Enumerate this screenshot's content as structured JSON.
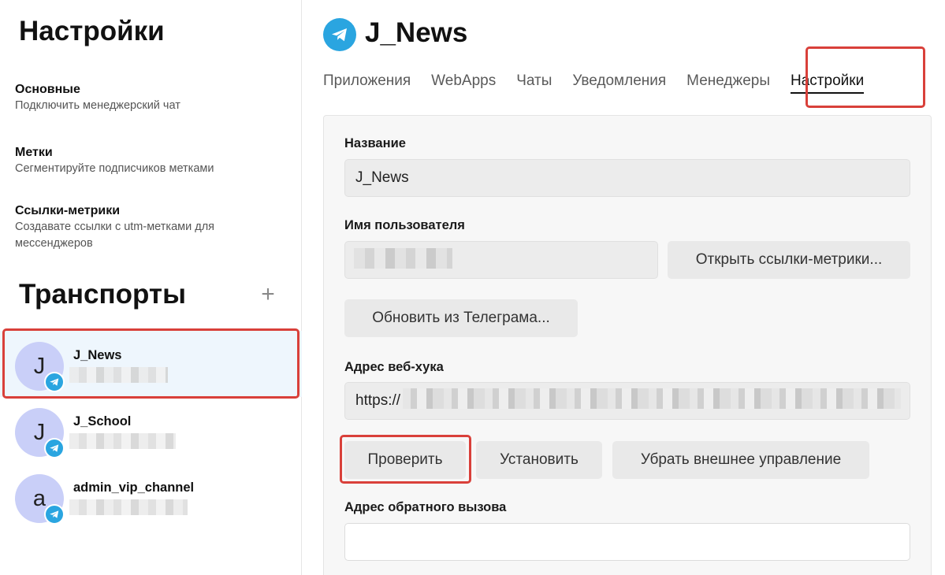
{
  "sidebar": {
    "title": "Настройки",
    "menu": [
      {
        "title": "Основные",
        "desc": "Подключить менеджерский чат"
      },
      {
        "title": "Метки",
        "desc": "Сегментируйте подписчиков метками"
      },
      {
        "title": "Ссылки-метрики",
        "desc": "Создавате ссылки с utm-метками для мессенджеров"
      }
    ],
    "transports_title": "Транспорты",
    "add_symbol": "+",
    "transports": [
      {
        "initial": "J",
        "name": "J_News",
        "icon": "telegram-icon",
        "selected": true
      },
      {
        "initial": "J",
        "name": "J_School",
        "icon": "telegram-icon",
        "selected": false
      },
      {
        "initial": "a",
        "name": "admin_vip_channel",
        "icon": "telegram-icon",
        "selected": false
      }
    ]
  },
  "header": {
    "title": "J_News",
    "icon": "telegram-icon",
    "tabs": [
      {
        "label": "Приложения",
        "active": false
      },
      {
        "label": "WebApps",
        "active": false
      },
      {
        "label": "Чаты",
        "active": false
      },
      {
        "label": "Уведомления",
        "active": false
      },
      {
        "label": "Менеджеры",
        "active": false
      },
      {
        "label": "Настройки",
        "active": true
      }
    ]
  },
  "form": {
    "name_label": "Название",
    "name_value": "J_News",
    "username_label": "Имя пользователя",
    "open_links_button": "Открыть ссылки-метрики...",
    "refresh_button": "Обновить из Телеграма...",
    "webhook_label": "Адрес веб-хука",
    "webhook_prefix": "https://",
    "check_button": "Проверить",
    "install_button": "Установить",
    "remove_control_button": "Убрать внешнее управление",
    "callback_label": "Адрес обратного вызова",
    "callback_value": ""
  },
  "colors": {
    "accent_telegram": "#2aa5e0",
    "highlight": "#d9403a",
    "avatar": "#c9cff8",
    "selected_row": "#eef6fd"
  }
}
